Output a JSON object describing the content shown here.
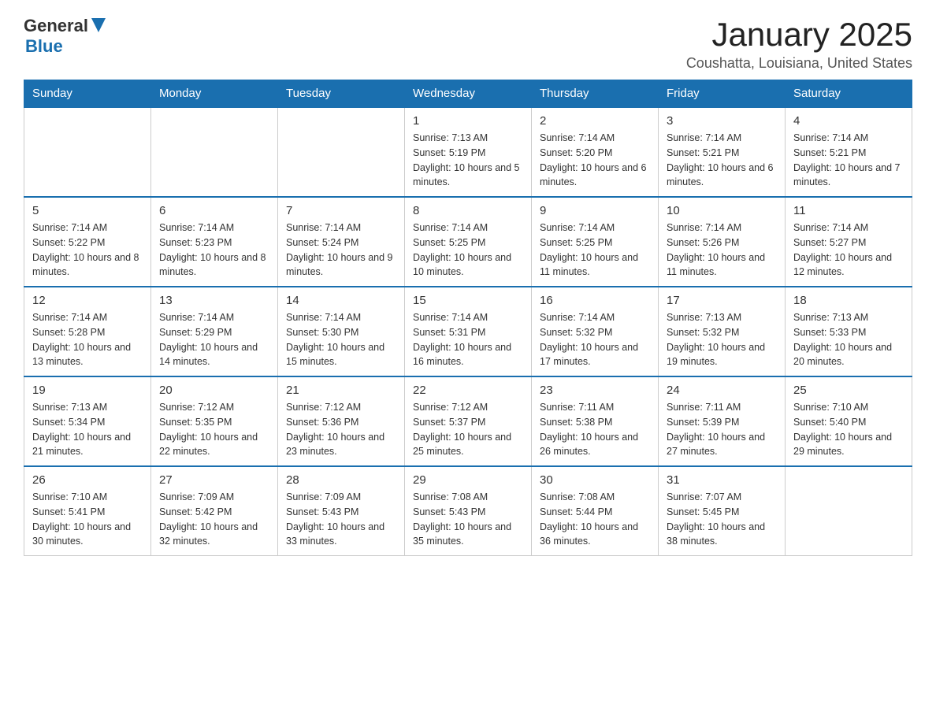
{
  "header": {
    "logo": {
      "general": "General",
      "arrow": "▶",
      "blue": "Blue"
    },
    "title": "January 2025",
    "subtitle": "Coushatta, Louisiana, United States"
  },
  "calendar": {
    "days_of_week": [
      "Sunday",
      "Monday",
      "Tuesday",
      "Wednesday",
      "Thursday",
      "Friday",
      "Saturday"
    ],
    "weeks": [
      [
        {
          "day": "",
          "info": ""
        },
        {
          "day": "",
          "info": ""
        },
        {
          "day": "",
          "info": ""
        },
        {
          "day": "1",
          "info": "Sunrise: 7:13 AM\nSunset: 5:19 PM\nDaylight: 10 hours and 5 minutes."
        },
        {
          "day": "2",
          "info": "Sunrise: 7:14 AM\nSunset: 5:20 PM\nDaylight: 10 hours and 6 minutes."
        },
        {
          "day": "3",
          "info": "Sunrise: 7:14 AM\nSunset: 5:21 PM\nDaylight: 10 hours and 6 minutes."
        },
        {
          "day": "4",
          "info": "Sunrise: 7:14 AM\nSunset: 5:21 PM\nDaylight: 10 hours and 7 minutes."
        }
      ],
      [
        {
          "day": "5",
          "info": "Sunrise: 7:14 AM\nSunset: 5:22 PM\nDaylight: 10 hours and 8 minutes."
        },
        {
          "day": "6",
          "info": "Sunrise: 7:14 AM\nSunset: 5:23 PM\nDaylight: 10 hours and 8 minutes."
        },
        {
          "day": "7",
          "info": "Sunrise: 7:14 AM\nSunset: 5:24 PM\nDaylight: 10 hours and 9 minutes."
        },
        {
          "day": "8",
          "info": "Sunrise: 7:14 AM\nSunset: 5:25 PM\nDaylight: 10 hours and 10 minutes."
        },
        {
          "day": "9",
          "info": "Sunrise: 7:14 AM\nSunset: 5:25 PM\nDaylight: 10 hours and 11 minutes."
        },
        {
          "day": "10",
          "info": "Sunrise: 7:14 AM\nSunset: 5:26 PM\nDaylight: 10 hours and 11 minutes."
        },
        {
          "day": "11",
          "info": "Sunrise: 7:14 AM\nSunset: 5:27 PM\nDaylight: 10 hours and 12 minutes."
        }
      ],
      [
        {
          "day": "12",
          "info": "Sunrise: 7:14 AM\nSunset: 5:28 PM\nDaylight: 10 hours and 13 minutes."
        },
        {
          "day": "13",
          "info": "Sunrise: 7:14 AM\nSunset: 5:29 PM\nDaylight: 10 hours and 14 minutes."
        },
        {
          "day": "14",
          "info": "Sunrise: 7:14 AM\nSunset: 5:30 PM\nDaylight: 10 hours and 15 minutes."
        },
        {
          "day": "15",
          "info": "Sunrise: 7:14 AM\nSunset: 5:31 PM\nDaylight: 10 hours and 16 minutes."
        },
        {
          "day": "16",
          "info": "Sunrise: 7:14 AM\nSunset: 5:32 PM\nDaylight: 10 hours and 17 minutes."
        },
        {
          "day": "17",
          "info": "Sunrise: 7:13 AM\nSunset: 5:32 PM\nDaylight: 10 hours and 19 minutes."
        },
        {
          "day": "18",
          "info": "Sunrise: 7:13 AM\nSunset: 5:33 PM\nDaylight: 10 hours and 20 minutes."
        }
      ],
      [
        {
          "day": "19",
          "info": "Sunrise: 7:13 AM\nSunset: 5:34 PM\nDaylight: 10 hours and 21 minutes."
        },
        {
          "day": "20",
          "info": "Sunrise: 7:12 AM\nSunset: 5:35 PM\nDaylight: 10 hours and 22 minutes."
        },
        {
          "day": "21",
          "info": "Sunrise: 7:12 AM\nSunset: 5:36 PM\nDaylight: 10 hours and 23 minutes."
        },
        {
          "day": "22",
          "info": "Sunrise: 7:12 AM\nSunset: 5:37 PM\nDaylight: 10 hours and 25 minutes."
        },
        {
          "day": "23",
          "info": "Sunrise: 7:11 AM\nSunset: 5:38 PM\nDaylight: 10 hours and 26 minutes."
        },
        {
          "day": "24",
          "info": "Sunrise: 7:11 AM\nSunset: 5:39 PM\nDaylight: 10 hours and 27 minutes."
        },
        {
          "day": "25",
          "info": "Sunrise: 7:10 AM\nSunset: 5:40 PM\nDaylight: 10 hours and 29 minutes."
        }
      ],
      [
        {
          "day": "26",
          "info": "Sunrise: 7:10 AM\nSunset: 5:41 PM\nDaylight: 10 hours and 30 minutes."
        },
        {
          "day": "27",
          "info": "Sunrise: 7:09 AM\nSunset: 5:42 PM\nDaylight: 10 hours and 32 minutes."
        },
        {
          "day": "28",
          "info": "Sunrise: 7:09 AM\nSunset: 5:43 PM\nDaylight: 10 hours and 33 minutes."
        },
        {
          "day": "29",
          "info": "Sunrise: 7:08 AM\nSunset: 5:43 PM\nDaylight: 10 hours and 35 minutes."
        },
        {
          "day": "30",
          "info": "Sunrise: 7:08 AM\nSunset: 5:44 PM\nDaylight: 10 hours and 36 minutes."
        },
        {
          "day": "31",
          "info": "Sunrise: 7:07 AM\nSunset: 5:45 PM\nDaylight: 10 hours and 38 minutes."
        },
        {
          "day": "",
          "info": ""
        }
      ]
    ]
  }
}
